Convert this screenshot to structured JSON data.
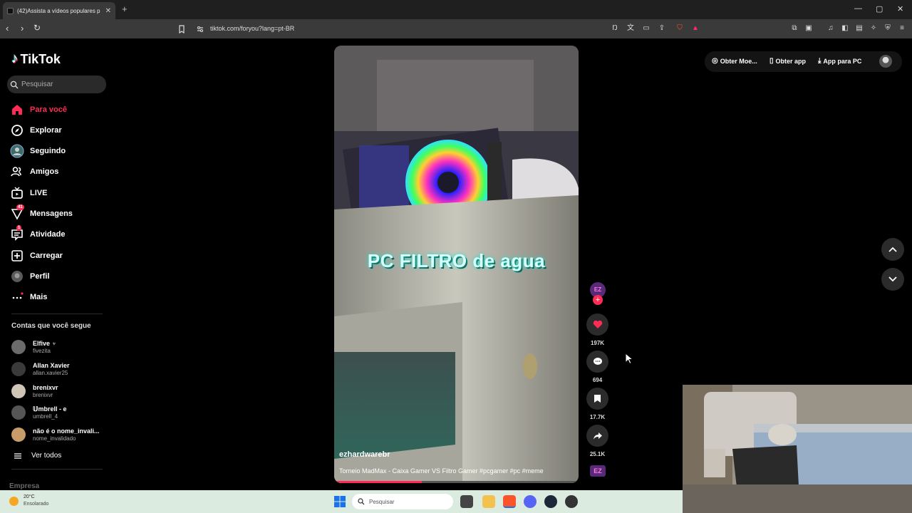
{
  "browser": {
    "tab_title": "(42)Assista a vídeos populares p",
    "tab_close": "✕",
    "new_tab": "+",
    "url": "tiktok.com/foryou?lang=pt-BR",
    "window_controls": [
      "—",
      "▢",
      "✕"
    ]
  },
  "sidebar": {
    "logo": "TikTok",
    "search_placeholder": "Pesquisar",
    "nav": [
      {
        "label": "Para você",
        "icon": "home-icon",
        "active": true
      },
      {
        "label": "Explorar",
        "icon": "compass-icon"
      },
      {
        "label": "Seguindo",
        "icon": "following-avatar-icon"
      },
      {
        "label": "Amigos",
        "icon": "friends-icon"
      },
      {
        "label": "LIVE",
        "icon": "live-icon"
      },
      {
        "label": "Mensagens",
        "icon": "messages-icon",
        "badge": "41"
      },
      {
        "label": "Atividade",
        "icon": "activity-icon",
        "badge": "1"
      },
      {
        "label": "Carregar",
        "icon": "upload-icon"
      },
      {
        "label": "Perfil",
        "icon": "profile-avatar-icon"
      },
      {
        "label": "Mais",
        "icon": "more-icon"
      }
    ],
    "following_title": "Contas que você segue",
    "following": [
      {
        "name": "Elfive ♆",
        "handle": "fivezita",
        "color": "#6b6b6b"
      },
      {
        "name": "Allan Xavier",
        "handle": "allan.xavier25",
        "color": "#3a3a3a"
      },
      {
        "name": "brenixvr",
        "handle": "brenixvr",
        "color": "#d0c6b8"
      },
      {
        "name": "𝕌mbrell - e",
        "handle": "umbrell_4",
        "color": "#555"
      },
      {
        "name": "não é o nome_invali...",
        "handle": "nome_invalidado",
        "color": "#c89b6a"
      }
    ],
    "see_all": "Ver todos",
    "footer": "Empresa"
  },
  "video": {
    "overlay_text": "PC FILTRO de agua",
    "username": "ezhardwarebr",
    "description": "Torneio MadMax - Caixa Gamer VS Filtro Gamer #pcgamer #pc #meme",
    "progress": 0.36
  },
  "actions": {
    "likes": "197K",
    "comments": "694",
    "saves": "17.7K",
    "shares": "25.1K"
  },
  "topright": {
    "coins": "Obter Moe...",
    "get_app": "Obter app",
    "pc_app": "App para PC"
  },
  "taskbar": {
    "temp": "20°C",
    "weather": "Ensolarado",
    "search": "Pesquisar"
  },
  "colors": {
    "accent": "#fe2c55",
    "page_bg": "#000000",
    "chrome_bg": "#3a3a3a",
    "taskbar_bg": "#dcebe0"
  }
}
